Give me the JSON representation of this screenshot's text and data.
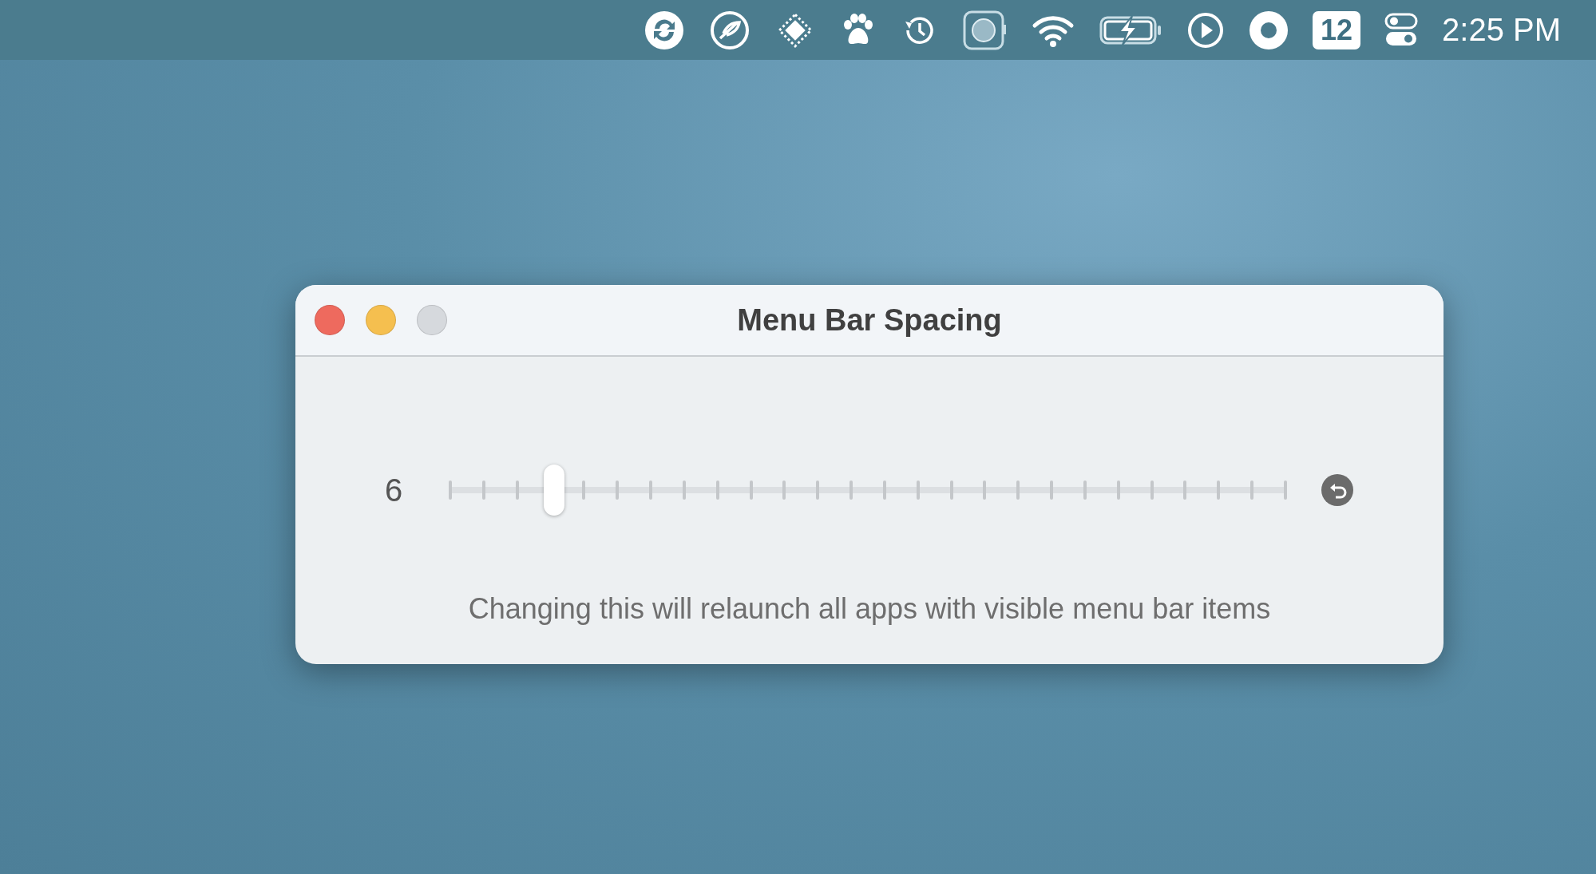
{
  "menu_bar": {
    "icons": [
      {
        "kind": "sync"
      },
      {
        "kind": "feather"
      },
      {
        "kind": "diamond"
      },
      {
        "kind": "paw"
      },
      {
        "kind": "history"
      },
      {
        "kind": "watch"
      },
      {
        "kind": "wifi"
      },
      {
        "kind": "battery"
      },
      {
        "kind": "play"
      },
      {
        "kind": "record"
      }
    ],
    "badge": "12",
    "clock": "2:25 PM"
  },
  "window": {
    "title": "Menu Bar Spacing",
    "controls": [
      {
        "kind": "close",
        "disabled": false
      },
      {
        "kind": "minimize",
        "disabled": false
      },
      {
        "kind": "zoom",
        "disabled": true
      }
    ]
  },
  "slider": {
    "value_label": "6",
    "level": 0.126
  },
  "note": "Changing this will relaunch all apps with visible menu bar items"
}
